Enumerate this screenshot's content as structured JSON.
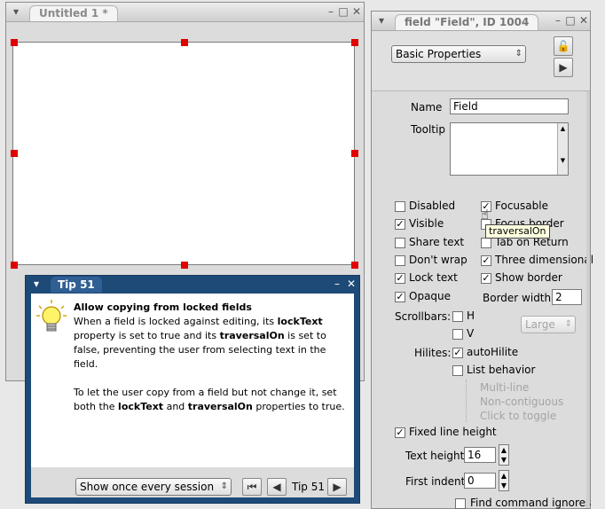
{
  "editor": {
    "title": "Untitled 1 *"
  },
  "inspector": {
    "title": "field \"Field\", ID 1004",
    "mode_selector": "Basic Properties",
    "name_label": "Name",
    "name_value": "Field",
    "tooltip_label": "Tooltip",
    "checkboxes_left": [
      {
        "label": "Disabled",
        "checked": false
      },
      {
        "label": "Visible",
        "checked": true
      },
      {
        "label": "Share text",
        "checked": false
      },
      {
        "label": "Don't wrap",
        "checked": false
      },
      {
        "label": "Lock text",
        "checked": true
      },
      {
        "label": "Opaque",
        "checked": true
      }
    ],
    "checkboxes_right": [
      {
        "label": "Focusable",
        "checked": true
      },
      {
        "label": "Focus border",
        "checked": false
      },
      {
        "label": "Tab on Return",
        "checked": false
      },
      {
        "label": "Three dimensional",
        "checked": true
      },
      {
        "label": "Show border",
        "checked": true
      }
    ],
    "hover_tooltip": "traversalOn",
    "border_width_label": "Border width",
    "border_width_value": "2",
    "scrollbars_label": "Scrollbars:",
    "scroll_h": "H",
    "scroll_v": "V",
    "scroll_size": "Large",
    "hilites_label": "Hilites:",
    "auto_hilite": "autoHilite",
    "list_behavior": "List behavior",
    "multi_line": "Multi-line",
    "non_contiguous": "Non-contiguous",
    "click_to_toggle": "Click to toggle",
    "fixed_line_height": "Fixed line height",
    "text_height_label": "Text height",
    "text_height_value": "16",
    "first_indent_label": "First indent",
    "first_indent_value": "0",
    "find_command": "Find command ignores"
  },
  "tip": {
    "title": "Tip 51",
    "heading": "Allow copying from locked fields",
    "p1_a": "When a field is locked against editing, its ",
    "p1_b": "lockText",
    "p1_c": " property is set to true and its ",
    "p1_d": "traversalOn",
    "p1_e": " is set to false, preventing the user from selecting text in the field.",
    "p2_a": "To let the user copy from a field but not change it, set both the ",
    "p2_b": "lockText",
    "p2_c": " and ",
    "p2_d": "traversalOn",
    "p2_e": " properties to true.",
    "frequency": "Show once every session",
    "counter": "Tip 51"
  },
  "colors": {
    "handle": "#e00000",
    "tip_titlebar": "#1e4a78",
    "tooltip_bg": "#ffffe0"
  }
}
